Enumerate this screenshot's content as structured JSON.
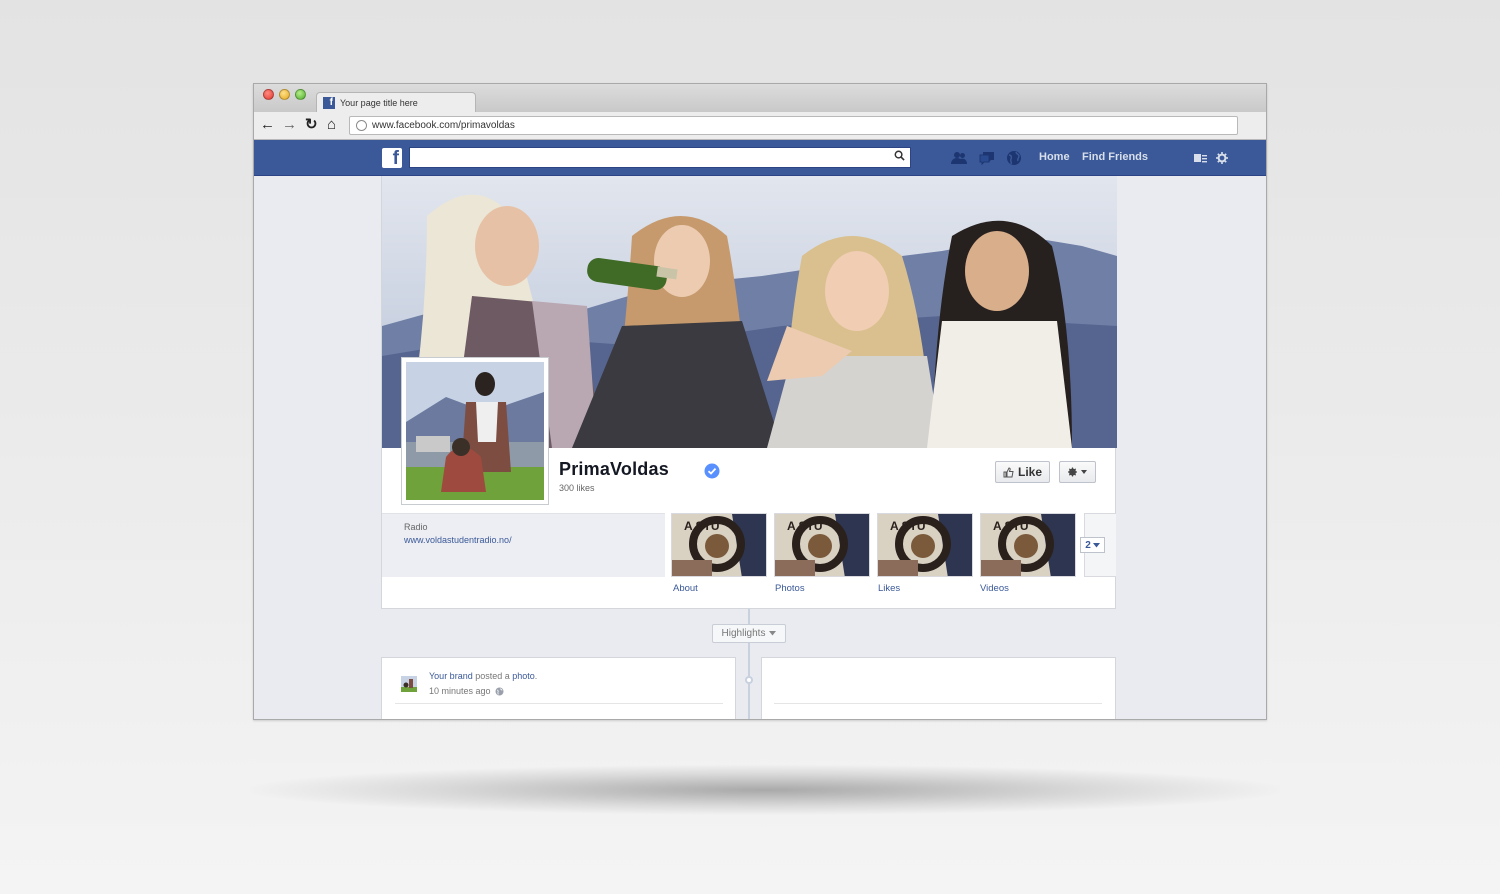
{
  "browser": {
    "tab_title": "Your page title here",
    "url": "www.facebook.com/primavoldas"
  },
  "fb_header": {
    "search_value": "",
    "nav_home": "Home",
    "nav_find_friends": "Find Friends",
    "icons": [
      "friend-requests-icon",
      "messages-icon",
      "notifications-globe-icon",
      "privacy-shortcuts-icon",
      "settings-gear-icon"
    ]
  },
  "page": {
    "name": "PrimaVoldas",
    "likes": "300 likes",
    "like_button": "Like",
    "category": "Radio",
    "website": "www.voldastudentradio.no/",
    "apps": [
      "About",
      "Photos",
      "Likes",
      "Videos"
    ],
    "more_count": "2",
    "highlights_label": "Highlights",
    "accent_color": "#3b5998"
  },
  "post": {
    "author": "Your brand",
    "action": " posted a ",
    "object": "photo",
    "tail": ".",
    "time": "10 minutes ago"
  }
}
